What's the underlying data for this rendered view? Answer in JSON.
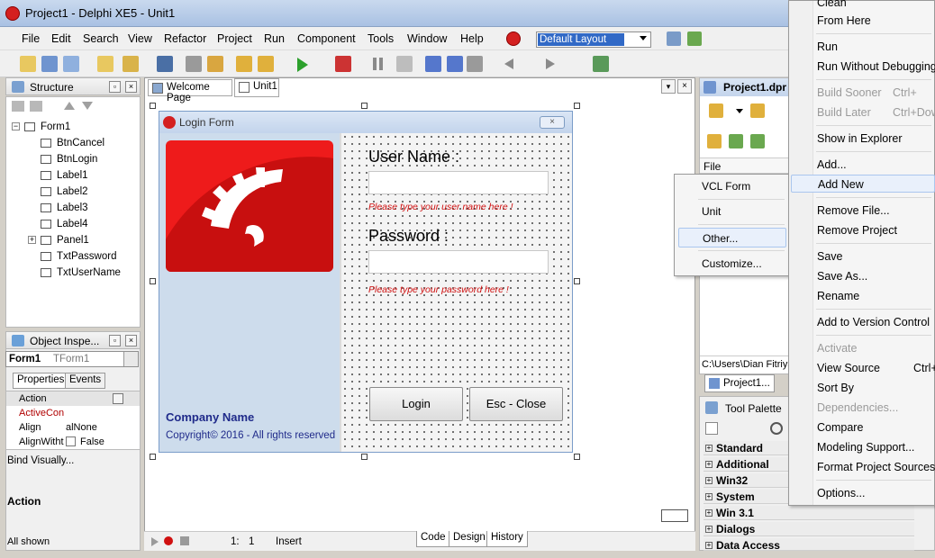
{
  "window": {
    "title": "Project1 - Delphi XE5 - Unit1"
  },
  "menubar": {
    "items": [
      "File",
      "Edit",
      "Search",
      "View",
      "Refactor",
      "Project",
      "Run",
      "Component",
      "Tools",
      "Window",
      "Help"
    ],
    "layout_combo": "Default Layout"
  },
  "structure": {
    "title": "Structure",
    "root": "Form1",
    "children": [
      "BtnCancel",
      "BtnLogin",
      "Label1",
      "Label2",
      "Label3",
      "Label4",
      "Panel1",
      "TxtPassword",
      "TxtUserName"
    ]
  },
  "object_inspector": {
    "title": "Object Inspe...",
    "selected_name": "Form1",
    "selected_type": "TForm1",
    "tabs": [
      "Properties",
      "Events"
    ],
    "rows": [
      {
        "key": "Action",
        "value": ""
      },
      {
        "key": "ActiveCon",
        "value": ""
      },
      {
        "key": "Align",
        "value": "alNone"
      },
      {
        "key": "AlignWitht",
        "value": "False"
      }
    ],
    "bind_visually": "Bind Visually...",
    "desc_title": "Action",
    "status": "All shown"
  },
  "editor": {
    "tabs": [
      "Welcome Page",
      "Unit1"
    ],
    "status": {
      "pos_line": "1:",
      "pos_col": "1",
      "mode": "Insert"
    },
    "bottom_tabs": [
      "Code",
      "Design",
      "History"
    ]
  },
  "login_form": {
    "title": "Login Form",
    "username_label": "User Name :",
    "username_hint": "Please type your user name here !",
    "password_label": "Password :",
    "password_hint": "Please type your password here !",
    "login_button": "Login",
    "close_button": "Esc - Close",
    "company": "Company Name",
    "copyright": "Copyright© 2016 - All rights reserved",
    "accent": "#ee1b1b"
  },
  "project_manager": {
    "title": "Project1.dpr",
    "column": "File",
    "path": "C:\\Users\\Dian Fitriya",
    "tab": "Project1...",
    "palette_title": "Tool Palette"
  },
  "palette_categories": [
    "Standard",
    "Additional",
    "Win32",
    "System",
    "Win 3.1",
    "Dialogs",
    "Data Access"
  ],
  "add_new_submenu": [
    "VCL Form",
    "Unit",
    "Other...",
    "Customize..."
  ],
  "context_menu": {
    "items": [
      {
        "label": "Clean",
        "shortcut": "",
        "disabled": false
      },
      {
        "label": "From Here",
        "shortcut": "",
        "disabled": false
      },
      {
        "label": "Run",
        "shortcut": "",
        "disabled": false
      },
      {
        "label": "Run Without Debugging",
        "shortcut": "",
        "disabled": false
      },
      {
        "label": "Build Sooner",
        "shortcut": "Ctrl+",
        "disabled": true
      },
      {
        "label": "Build Later",
        "shortcut": "Ctrl+Dow",
        "disabled": true
      },
      {
        "label": "Show in Explorer",
        "shortcut": "",
        "disabled": false
      },
      {
        "label": "Add...",
        "shortcut": "",
        "disabled": false
      },
      {
        "label": "Add New",
        "shortcut": "",
        "disabled": false
      },
      {
        "label": "Remove File...",
        "shortcut": "",
        "disabled": false
      },
      {
        "label": "Remove Project",
        "shortcut": "",
        "disabled": false
      },
      {
        "label": "Save",
        "shortcut": "",
        "disabled": false
      },
      {
        "label": "Save As...",
        "shortcut": "",
        "disabled": false
      },
      {
        "label": "Rename",
        "shortcut": "",
        "disabled": false
      },
      {
        "label": "Add to Version Control",
        "shortcut": "",
        "disabled": false
      },
      {
        "label": "Activate",
        "shortcut": "",
        "disabled": true
      },
      {
        "label": "View Source",
        "shortcut": "Ctrl+",
        "disabled": false
      },
      {
        "label": "Sort By",
        "shortcut": "",
        "disabled": false
      },
      {
        "label": "Dependencies...",
        "shortcut": "",
        "disabled": true
      },
      {
        "label": "Compare",
        "shortcut": "",
        "disabled": false
      },
      {
        "label": "Modeling Support...",
        "shortcut": "",
        "disabled": false
      },
      {
        "label": "Format Project Sources...",
        "shortcut": "",
        "disabled": false
      },
      {
        "label": "Options...",
        "shortcut": "",
        "disabled": false
      }
    ]
  }
}
